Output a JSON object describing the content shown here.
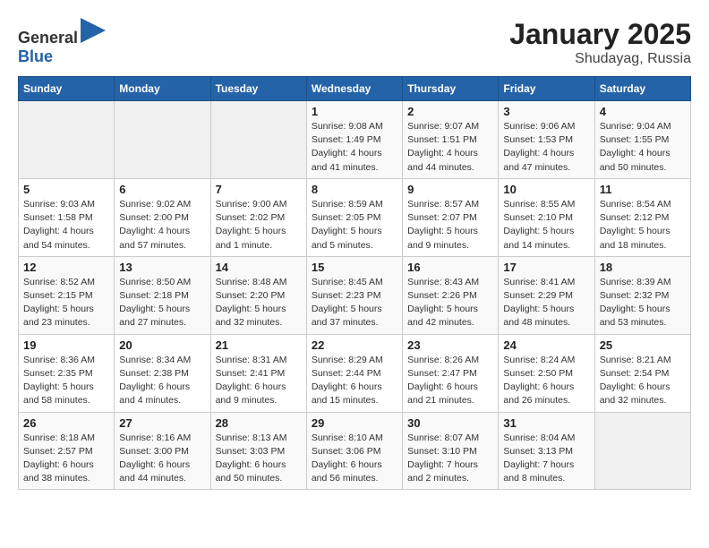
{
  "header": {
    "logo_general": "General",
    "logo_blue": "Blue",
    "month": "January 2025",
    "location": "Shudayag, Russia"
  },
  "weekdays": [
    "Sunday",
    "Monday",
    "Tuesday",
    "Wednesday",
    "Thursday",
    "Friday",
    "Saturday"
  ],
  "weeks": [
    [
      {
        "day": "",
        "info": ""
      },
      {
        "day": "",
        "info": ""
      },
      {
        "day": "",
        "info": ""
      },
      {
        "day": "1",
        "info": "Sunrise: 9:08 AM\nSunset: 1:49 PM\nDaylight: 4 hours\nand 41 minutes."
      },
      {
        "day": "2",
        "info": "Sunrise: 9:07 AM\nSunset: 1:51 PM\nDaylight: 4 hours\nand 44 minutes."
      },
      {
        "day": "3",
        "info": "Sunrise: 9:06 AM\nSunset: 1:53 PM\nDaylight: 4 hours\nand 47 minutes."
      },
      {
        "day": "4",
        "info": "Sunrise: 9:04 AM\nSunset: 1:55 PM\nDaylight: 4 hours\nand 50 minutes."
      }
    ],
    [
      {
        "day": "5",
        "info": "Sunrise: 9:03 AM\nSunset: 1:58 PM\nDaylight: 4 hours\nand 54 minutes."
      },
      {
        "day": "6",
        "info": "Sunrise: 9:02 AM\nSunset: 2:00 PM\nDaylight: 4 hours\nand 57 minutes."
      },
      {
        "day": "7",
        "info": "Sunrise: 9:00 AM\nSunset: 2:02 PM\nDaylight: 5 hours\nand 1 minute."
      },
      {
        "day": "8",
        "info": "Sunrise: 8:59 AM\nSunset: 2:05 PM\nDaylight: 5 hours\nand 5 minutes."
      },
      {
        "day": "9",
        "info": "Sunrise: 8:57 AM\nSunset: 2:07 PM\nDaylight: 5 hours\nand 9 minutes."
      },
      {
        "day": "10",
        "info": "Sunrise: 8:55 AM\nSunset: 2:10 PM\nDaylight: 5 hours\nand 14 minutes."
      },
      {
        "day": "11",
        "info": "Sunrise: 8:54 AM\nSunset: 2:12 PM\nDaylight: 5 hours\nand 18 minutes."
      }
    ],
    [
      {
        "day": "12",
        "info": "Sunrise: 8:52 AM\nSunset: 2:15 PM\nDaylight: 5 hours\nand 23 minutes."
      },
      {
        "day": "13",
        "info": "Sunrise: 8:50 AM\nSunset: 2:18 PM\nDaylight: 5 hours\nand 27 minutes."
      },
      {
        "day": "14",
        "info": "Sunrise: 8:48 AM\nSunset: 2:20 PM\nDaylight: 5 hours\nand 32 minutes."
      },
      {
        "day": "15",
        "info": "Sunrise: 8:45 AM\nSunset: 2:23 PM\nDaylight: 5 hours\nand 37 minutes."
      },
      {
        "day": "16",
        "info": "Sunrise: 8:43 AM\nSunset: 2:26 PM\nDaylight: 5 hours\nand 42 minutes."
      },
      {
        "day": "17",
        "info": "Sunrise: 8:41 AM\nSunset: 2:29 PM\nDaylight: 5 hours\nand 48 minutes."
      },
      {
        "day": "18",
        "info": "Sunrise: 8:39 AM\nSunset: 2:32 PM\nDaylight: 5 hours\nand 53 minutes."
      }
    ],
    [
      {
        "day": "19",
        "info": "Sunrise: 8:36 AM\nSunset: 2:35 PM\nDaylight: 5 hours\nand 58 minutes."
      },
      {
        "day": "20",
        "info": "Sunrise: 8:34 AM\nSunset: 2:38 PM\nDaylight: 6 hours\nand 4 minutes."
      },
      {
        "day": "21",
        "info": "Sunrise: 8:31 AM\nSunset: 2:41 PM\nDaylight: 6 hours\nand 9 minutes."
      },
      {
        "day": "22",
        "info": "Sunrise: 8:29 AM\nSunset: 2:44 PM\nDaylight: 6 hours\nand 15 minutes."
      },
      {
        "day": "23",
        "info": "Sunrise: 8:26 AM\nSunset: 2:47 PM\nDaylight: 6 hours\nand 21 minutes."
      },
      {
        "day": "24",
        "info": "Sunrise: 8:24 AM\nSunset: 2:50 PM\nDaylight: 6 hours\nand 26 minutes."
      },
      {
        "day": "25",
        "info": "Sunrise: 8:21 AM\nSunset: 2:54 PM\nDaylight: 6 hours\nand 32 minutes."
      }
    ],
    [
      {
        "day": "26",
        "info": "Sunrise: 8:18 AM\nSunset: 2:57 PM\nDaylight: 6 hours\nand 38 minutes."
      },
      {
        "day": "27",
        "info": "Sunrise: 8:16 AM\nSunset: 3:00 PM\nDaylight: 6 hours\nand 44 minutes."
      },
      {
        "day": "28",
        "info": "Sunrise: 8:13 AM\nSunset: 3:03 PM\nDaylight: 6 hours\nand 50 minutes."
      },
      {
        "day": "29",
        "info": "Sunrise: 8:10 AM\nSunset: 3:06 PM\nDaylight: 6 hours\nand 56 minutes."
      },
      {
        "day": "30",
        "info": "Sunrise: 8:07 AM\nSunset: 3:10 PM\nDaylight: 7 hours\nand 2 minutes."
      },
      {
        "day": "31",
        "info": "Sunrise: 8:04 AM\nSunset: 3:13 PM\nDaylight: 7 hours\nand 8 minutes."
      },
      {
        "day": "",
        "info": ""
      }
    ]
  ]
}
